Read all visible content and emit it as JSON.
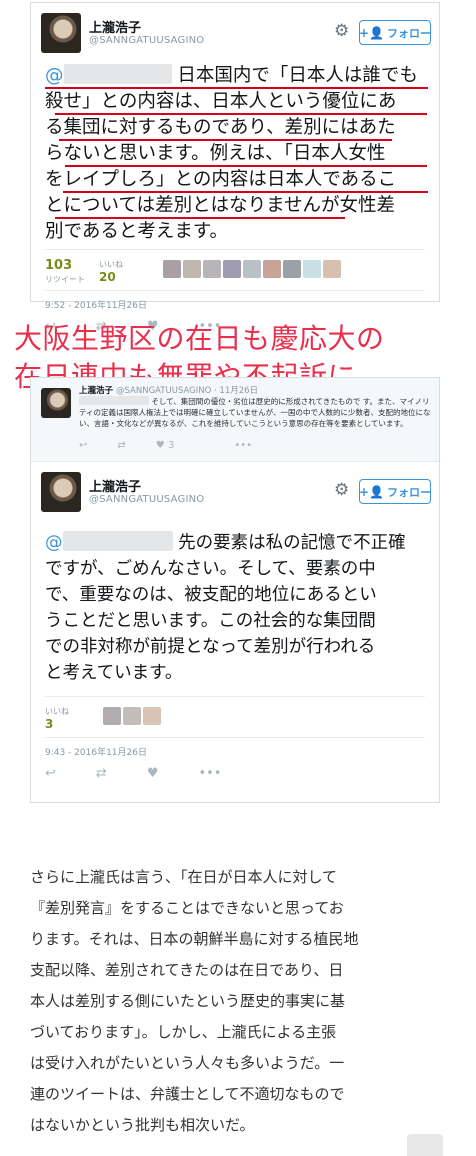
{
  "tweet1": {
    "name": "上瀧浩子",
    "handle": "@SANNGATUUSAGINO",
    "follow_label": "フォロー",
    "mention_prefix": "@",
    "lines": [
      "日本国内で「日本人は誰でも",
      "殺せ」との内容は、日本人という優位にあ",
      "る集団に対するものであり、差別にはあた",
      "らないと思います。例えは、「日本人女性",
      "をレイプしろ」との内容は日本人であるこ",
      "とについては差別とはなりませんが女性差",
      "別であると考えます。"
    ],
    "retweets_count": "103",
    "retweets_label": "リツイート",
    "likes_label": "いいね",
    "likes_count": "20",
    "time": "9:52 - 2016年11月26日"
  },
  "headline": {
    "line1": "大阪生野区の在日も慶応大の",
    "line2": "在日連中も無罪や不起訴に…"
  },
  "tweet2": {
    "reply_name": "上瀧浩子",
    "reply_handle": "@SANNGATUUSAGINO · 11月26日",
    "reply_text": "そして、集団間の優位・劣位は歴史的に形成されてきたもので す。また、マイノリティの定義は国際人権法上では明確に確立していませんが、一国の中で人数的に少数者、支配的地位にない、言語・文化などが異なるが、これを維持していこうという意思の存在等を要素としています。",
    "reply_likes": "3",
    "name": "上瀧浩子",
    "handle": "@SANNGATUUSAGINO",
    "follow_label": "フォロー",
    "mention_prefix": "@",
    "lines": [
      "先の要素は私の記憶で不正確",
      "ですが、ごめんなさい。そして、要素の中",
      "で、重要なのは、被支配的地位にあるとい",
      "うことだと思います。この社会的な集団間",
      "での非対称が前提となって差別が行われる",
      "と考えています。"
    ],
    "likes_label": "いいね",
    "likes_count": "3",
    "time": "9:43 - 2016年11月26日"
  },
  "article": {
    "lines": [
      "さらに上瀧氏は言う、「在日が日本人に対して",
      "『差別発言』をすることはできないと思ってお",
      "ります。それは、日本の朝鮮半島に対する植民地",
      "支配以降、差別されてきたのは在日であり、日",
      "本人は差別する側にいたという歴史的事実に基",
      "づいております」。しかし、上瀧氏による主張",
      "は受け入れがたいという人々も多いようだ。一",
      "連のツイートは、弁護士として不適切なもので",
      "はないかという批判も相次いだ。"
    ]
  },
  "colors": {
    "accent": "#3b94d9",
    "headline": "#e8304d",
    "underline": "#d6001c"
  },
  "icons": [
    "gear-icon",
    "person-plus-icon",
    "reply-icon",
    "retweet-icon",
    "heart-icon",
    "more-icon"
  ]
}
